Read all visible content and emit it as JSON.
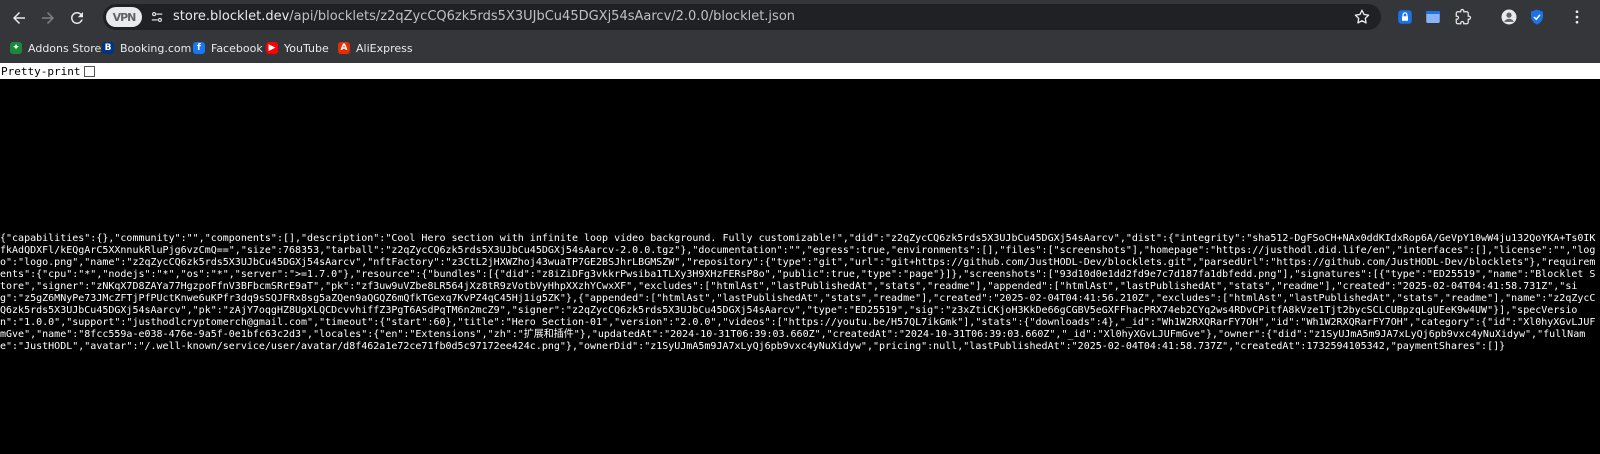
{
  "browser": {
    "vpn_label": "VPN",
    "url_host": "store.blocklet.dev",
    "url_path": "/api/blocklets/z2qZycCQ6zk5rds5X3UJbCu45DGXj54sAarcv/2.0.0/blocklet.json"
  },
  "bookmarks": [
    {
      "label": "Addons Store",
      "icon": "addons-store-icon",
      "color": "#1a8a3a"
    },
    {
      "label": "Booking.com",
      "icon": "booking-icon",
      "color": "#003580"
    },
    {
      "label": "Facebook",
      "icon": "facebook-icon",
      "color": "#1877f2"
    },
    {
      "label": "YouTube",
      "icon": "youtube-icon",
      "color": "#ff0000"
    },
    {
      "label": "AliExpress",
      "icon": "aliexpress-icon",
      "color": "#e62e04"
    }
  ],
  "pretty_print": {
    "label": "Pretty-print",
    "checked": false
  },
  "json_text": "{\"capabilities\":{},\"community\":\"\",\"components\":[],\"description\":\"Cool Hero section with infinite loop video background. Fully customizable!\",\"did\":\"z2qZycCQ6zk5rds5X3UJbCu45DGXj54sAarcv\",\"dist\":{\"integrity\":\"sha512-DgFSoCH+NAx0ddKIdxRop6A/GeVpY10wW4ju132QoYKA+Ts0IKfkAdQDXFl/kEQgArC5XXnnukRluPjg6vzCmQ==\",\"size\":768353,\"tarball\":\"z2qZycCQ6zk5rds5X3UJbCu45DGXj54sAarcv-2.0.0.tgz\"},\"documentation\":\"\",\"egress\":true,\"environments\":[],\"files\":[\"screenshots\"],\"homepage\":\"https://justhodl.did.life/en\",\"interfaces\":[],\"license\":\"\",\"logo\":\"logo.png\",\"name\":\"z2qZycCQ6zk5rds5X3UJbCu45DGXj54sAarcv\",\"nftFactory\":\"z3CtL2jHXWZhoj43wuaTP7GE2BSJhrLBGMSZW\",\"repository\":{\"type\":\"git\",\"url\":\"git+https://github.com/JustHODL-Dev/blocklets.git\",\"parsedUrl\":\"https://github.com/JustHODL-Dev/blocklets\"},\"requirements\":{\"cpu\":\"*\",\"nodejs\":\"*\",\"os\":\"*\",\"server\":\">=1.7.0\"},\"resource\":{\"bundles\":[{\"did\":\"z8iZiDFg3vkkrPwsiba1TLXy3H9XHzFERsP8o\",\"public\":true,\"type\":\"page\"}]},\"screenshots\":[\"93d10d0e1dd2fd9e7c7d187fa1dbfedd.png\"],\"signatures\":[{\"type\":\"ED25519\",\"name\":\"Blocklet Store\",\"signer\":\"zNKqX7D8ZAYa77HgzpoFfnV3BFbcmSRrE9aT\",\"pk\":\"zf3uw9uVZbe8LR564jXz8tR9zVotbVyHhpXXzhYCwxXF\",\"excludes\":[\"htmlAst\",\"lastPublishedAt\",\"stats\",\"readme\"],\"appended\":[\"htmlAst\",\"lastPublishedAt\",\"stats\",\"readme\"],\"created\":\"2025-02-04T04:41:58.731Z\",\"sig\":\"z5gZ6MNyPe73JMcZFTjPfPUctKnwe6uKPfr3dq9sSQJFRx8sg5aZQen9aQGQZ6mQfkTGexq7KvPZ4qC45Hj1ig5ZK\"},{\"appended\":[\"htmlAst\",\"lastPublishedAt\",\"stats\",\"readme\"],\"created\":\"2025-02-04T04:41:56.210Z\",\"excludes\":[\"htmlAst\",\"lastPublishedAt\",\"stats\",\"readme\"],\"name\":\"z2qZycCQ6zk5rds5X3UJbCu45DGXj54sAarcv\",\"pk\":\"zAjY7oqgHZ8UgXLQCDcvvhiffZ3PgT6ASdPqTM6n2mcZ9\",\"signer\":\"z2qZycCQ6zk5rds5X3UJbCu45DGXj54sAarcv\",\"type\":\"ED25519\",\"sig\":\"z3xZtiCKjoH3KkDe66gCGBV5eGXFFhacPRX74eb2CYq2ws4RDvCPitfA8kVze1Tjt2bycSCLCUBpzqLgUEeK9w4UW\"}],\"specVersion\":\"1.0.0\",\"support\":\"justhodlcryptomerch@gmail.com\",\"timeout\":{\"start\":60},\"title\":\"Hero Section-01\",\"version\":\"2.0.0\",\"videos\":[\"https://youtu.be/H57QL7ikGmk\"],\"stats\":{\"downloads\":4},\"_id\":\"Wh1W2RXQRarFY7OH\",\"id\":\"Wh1W2RXQRarFY7OH\",\"category\":{\"id\":\"Xl0hyXGvLJUFmGve\",\"name\":\"8fcc559a-e038-476e-9a5f-0e1bfc63c2d3\",\"locales\":{\"en\":\"Extensions\",\"zh\":\"扩展和插件\"},\"updatedAt\":\"2024-10-31T06:39:03.660Z\",\"createdAt\":\"2024-10-31T06:39:03.660Z\",\"_id\":\"Xl0hyXGvLJUFmGve\"},\"owner\":{\"did\":\"z1SyUJmA5m9JA7xLyQj6pb9vxc4yNuXidyw\",\"fullName\":\"JustHODL\",\"avatar\":\"/.well-known/service/user/avatar/d8f462a1e72ce71fb0d5c97172ee424c.png\"},\"ownerDid\":\"z1SyUJmA5m9JA7xLyQj6pb9vxc4yNuXidyw\",\"pricing\":null,\"lastPublishedAt\":\"2025-02-04T04:41:58.737Z\",\"createdAt\":1732594105342,\"paymentShares\":[]}"
}
